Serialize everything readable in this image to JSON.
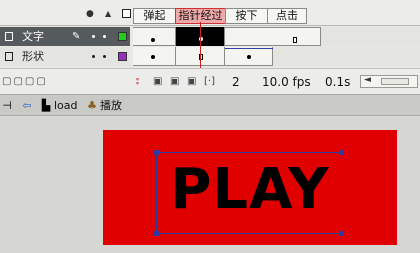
{
  "frame_headers": [
    "弹起",
    "指针经过",
    "按下",
    "点击"
  ],
  "active_frame": "指针经过",
  "layers": [
    {
      "name": "文字",
      "selected": true,
      "color": "#22cc22"
    },
    {
      "name": "形状",
      "selected": false,
      "color": "#9a30c0"
    }
  ],
  "timeline_status": {
    "current_frame": "2",
    "fps": "10.0 fps",
    "elapsed_time": "0.1s"
  },
  "edit_bar": {
    "scene": "load",
    "symbol": "播放"
  },
  "stage": {
    "button_label": "PLAY",
    "button_color": "#e00000"
  }
}
